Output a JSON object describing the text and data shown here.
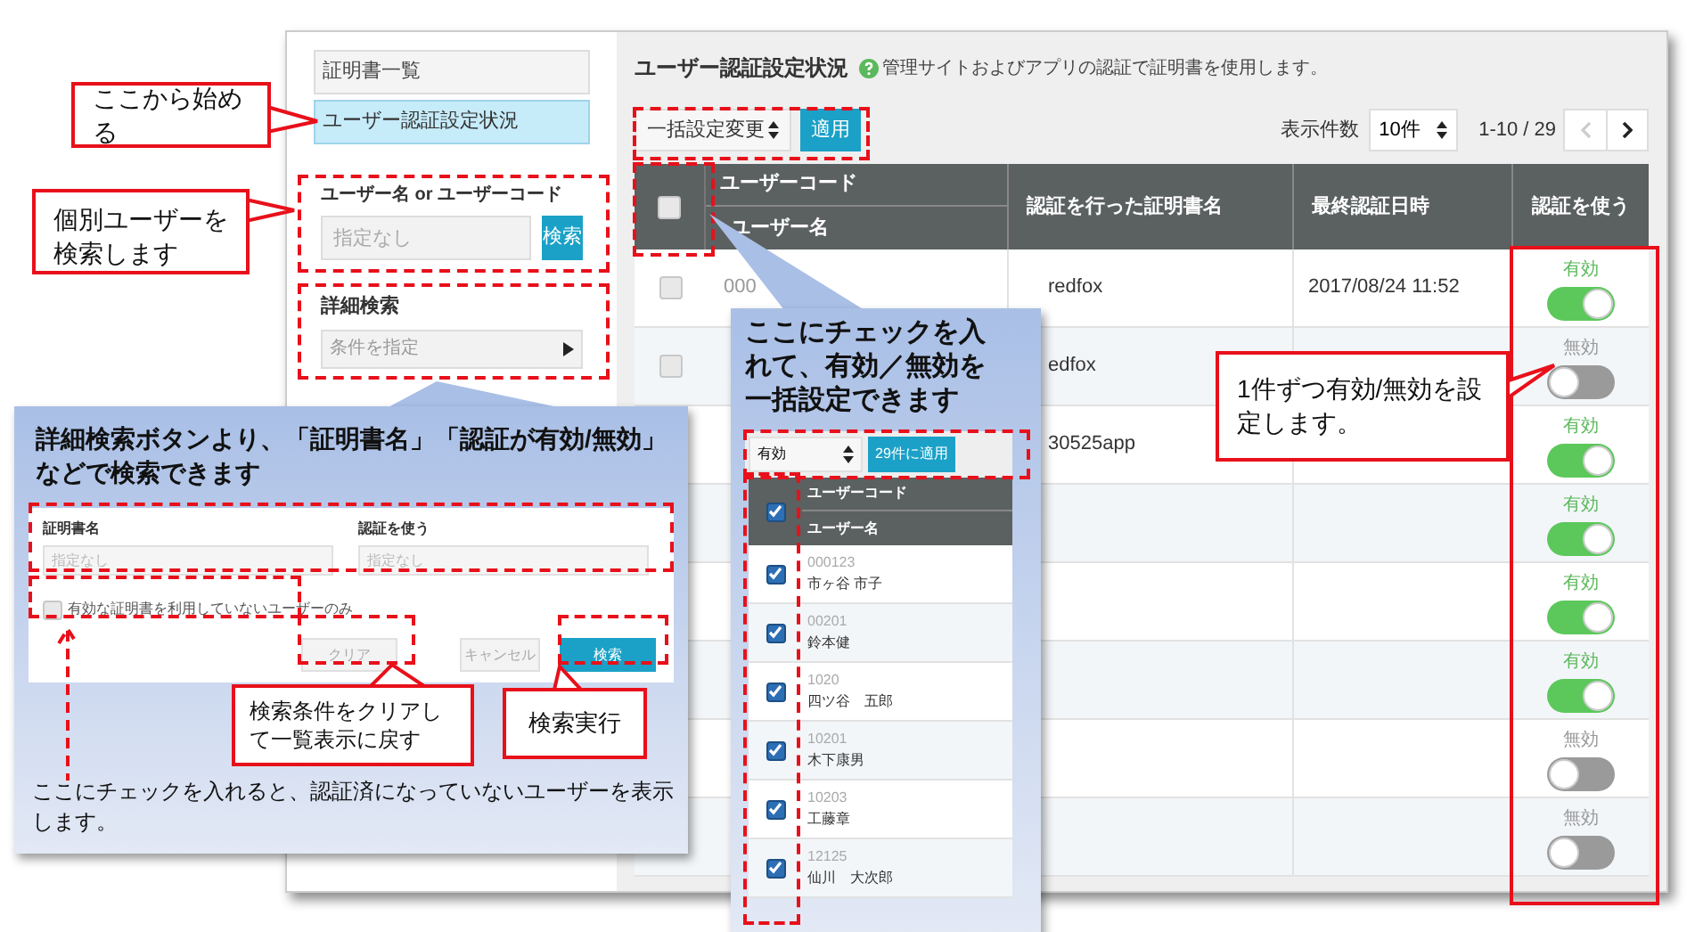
{
  "sidebar": {
    "items": [
      {
        "label": "証明書一覧",
        "selected": false
      },
      {
        "label": "ユーザー認証設定状況",
        "selected": true
      }
    ],
    "user_search": {
      "label": "ユーザー名 or ユーザーコード",
      "placeholder": "指定なし",
      "button": "検索"
    },
    "detail_search": {
      "label": "詳細検索",
      "value": "条件を指定"
    }
  },
  "main": {
    "title": "ユーザー認証設定状況",
    "help": "管理サイトおよびアプリの認証で証明書を使用します。",
    "bulk_select": "一括設定変更",
    "apply": "適用",
    "page_size_label": "表示件数",
    "page_size": "10件",
    "range": "1-10 / 29"
  },
  "table": {
    "header_checked": false,
    "columns": [
      "ユーザーコード",
      "ユーザー名",
      "認証を行った証明書名",
      "最終認証日時",
      "認証を使う"
    ],
    "rows": [
      {
        "checked": false,
        "code": "000",
        "certificate": "redfox",
        "last_auth": "2017/08/24 11:52",
        "on": true,
        "status": "有効"
      },
      {
        "checked": false,
        "certificate": "edfox",
        "on": false,
        "status": "無効"
      },
      {
        "certificate": "30525app",
        "on": true,
        "status": "有効"
      },
      {
        "on": true,
        "status": "有効"
      },
      {
        "on": true,
        "status": "有効"
      },
      {
        "on": true,
        "status": "有効"
      },
      {
        "on": false,
        "status": "無効"
      },
      {
        "on": false,
        "status": "無効"
      }
    ]
  },
  "annotations": {
    "start_note": "ここから始める",
    "user_search_note": "個別ユーザーを検索します",
    "detail_panel": {
      "title": "詳細検索ボタンより、「証明書名」「認証が有効/無効」などで検索できます",
      "fields": [
        {
          "label": "証明書名",
          "placeholder": "指定なし"
        },
        {
          "label": "認証を使う",
          "placeholder": "指定なし"
        }
      ],
      "checkbox": {
        "label": "有効な証明書を利用していないユーザーのみ",
        "checked": false
      },
      "buttons": [
        {
          "kind": "clear",
          "label": "クリア"
        },
        {
          "kind": "cancel",
          "label": "キャンセル"
        },
        {
          "kind": "search",
          "label": "検索"
        }
      ],
      "clear_note": "検索条件をクリアして一覧表示に戻す",
      "search_note": "検索実行",
      "checkbox_note": "ここにチェックを入れると、認証済になっていないユーザーを表示します。"
    },
    "bulk_panel": {
      "title": "ここにチェックを入れて、有効／無効を一括設定できます",
      "select": "有効",
      "apply": "29件に適用",
      "columns": [
        "ユーザーコード",
        "ユーザー名"
      ],
      "header_checked": true,
      "rows": [
        {
          "code": "000123",
          "name": "市ヶ谷 市子",
          "checked": true
        },
        {
          "code": "00201",
          "name": "鈴本健",
          "checked": true
        },
        {
          "code": "1020",
          "name": "四ツ谷　五郎",
          "checked": true
        },
        {
          "code": "10201",
          "name": "木下康男",
          "checked": true
        },
        {
          "code": "10203",
          "name": "工藤章",
          "checked": true
        },
        {
          "code": "12125",
          "name": "仙川　大次郎",
          "checked": true
        }
      ]
    },
    "toggle_note": "1件ずつ有効/無効を設定します。"
  }
}
